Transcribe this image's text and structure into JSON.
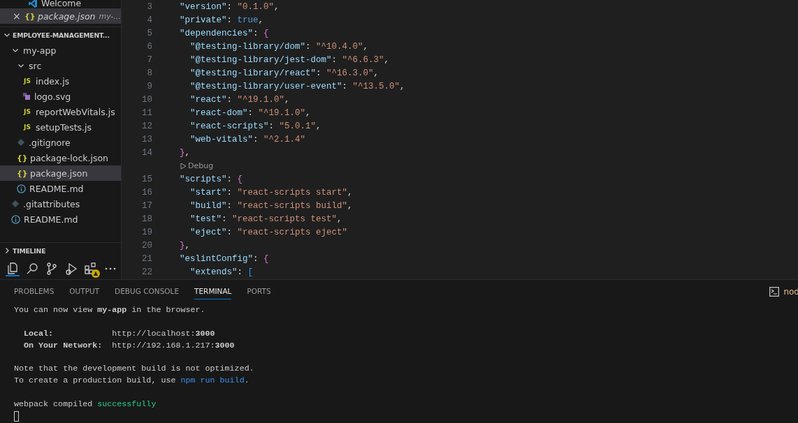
{
  "open_editors": [
    {
      "kind": "vscode",
      "name": "Welcome",
      "selected": false,
      "preview": false
    },
    {
      "kind": "json",
      "badge": "{}",
      "name": "package.json",
      "description": "my-...",
      "close": "×",
      "selected": true,
      "preview": true
    }
  ],
  "explorer": {
    "title": "EMPLOYEE-MANAGEMENT...",
    "expanded": true,
    "items": [
      {
        "name": "my-app",
        "kind": "folder",
        "expanded": true,
        "selected": false,
        "children": [
          {
            "name": "src",
            "kind": "folder",
            "expanded": true,
            "selected": false,
            "children": [
              {
                "name": "index.js",
                "kind": "js",
                "badge": "JS",
                "selected": false
              },
              {
                "name": "logo.svg",
                "kind": "svg",
                "selected": false
              },
              {
                "name": "reportWebVitals.js",
                "kind": "js",
                "badge": "JS",
                "selected": false
              },
              {
                "name": "setupTests.js",
                "kind": "js",
                "badge": "JS",
                "selected": false
              }
            ]
          },
          {
            "name": ".gitignore",
            "kind": "git",
            "selected": false
          },
          {
            "name": "package-lock.json",
            "kind": "json",
            "badge": "{}",
            "selected": false
          },
          {
            "name": "package.json",
            "kind": "json",
            "badge": "{}",
            "selected": true
          },
          {
            "name": "README.md",
            "kind": "info",
            "selected": false
          }
        ]
      },
      {
        "name": ".gitattributes",
        "kind": "git",
        "selected": false
      },
      {
        "name": "README.md",
        "kind": "info",
        "selected": false
      }
    ]
  },
  "timeline": {
    "title": "TIMELINE",
    "expanded": false
  },
  "activity_bar": [
    {
      "kind": "explorer",
      "selected": true
    },
    {
      "kind": "search",
      "selected": false
    },
    {
      "kind": "source-control",
      "selected": false
    },
    {
      "kind": "run-debug",
      "selected": false
    },
    {
      "kind": "extensions",
      "selected": false,
      "warning": true
    },
    {
      "kind": "more",
      "selected": false
    }
  ],
  "editor": {
    "lines": [
      {
        "kind": "code",
        "number": "3",
        "tokens": [
          {
            "kind": "key",
            "text": "\"version\""
          },
          {
            "kind": "punct",
            "text": ": "
          },
          {
            "kind": "string",
            "text": "\"0.1.0\""
          },
          {
            "kind": "punct",
            "text": ","
          }
        ]
      },
      {
        "kind": "code",
        "number": "4",
        "tokens": [
          {
            "kind": "key",
            "text": "\"private\""
          },
          {
            "kind": "punct",
            "text": ": "
          },
          {
            "kind": "bool",
            "text": "true"
          },
          {
            "kind": "punct",
            "text": ","
          }
        ]
      },
      {
        "kind": "code",
        "number": "5",
        "tokens": [
          {
            "kind": "key",
            "text": "\"dependencies\""
          },
          {
            "kind": "punct",
            "text": ": "
          },
          {
            "kind": "bracket2",
            "text": "{"
          }
        ]
      },
      {
        "kind": "code",
        "number": "6",
        "tokens": [
          {
            "kind": "key",
            "text": "\"@testing-library/dom\""
          },
          {
            "kind": "punct",
            "text": ": "
          },
          {
            "kind": "string",
            "text": "\"^10.4.0\""
          },
          {
            "kind": "punct",
            "text": ","
          }
        ]
      },
      {
        "kind": "code",
        "number": "7",
        "tokens": [
          {
            "kind": "key",
            "text": "\"@testing-library/jest-dom\""
          },
          {
            "kind": "punct",
            "text": ": "
          },
          {
            "kind": "string",
            "text": "\"^6.6.3\""
          },
          {
            "kind": "punct",
            "text": ","
          }
        ]
      },
      {
        "kind": "code",
        "number": "8",
        "tokens": [
          {
            "kind": "key",
            "text": "\"@testing-library/react\""
          },
          {
            "kind": "punct",
            "text": ": "
          },
          {
            "kind": "string",
            "text": "\"^16.3.0\""
          },
          {
            "kind": "punct",
            "text": ","
          }
        ]
      },
      {
        "kind": "code",
        "number": "9",
        "tokens": [
          {
            "kind": "key",
            "text": "\"@testing-library/user-event\""
          },
          {
            "kind": "punct",
            "text": ": "
          },
          {
            "kind": "string",
            "text": "\"^13.5.0\""
          },
          {
            "kind": "punct",
            "text": ","
          }
        ]
      },
      {
        "kind": "code",
        "number": "10",
        "tokens": [
          {
            "kind": "key",
            "text": "\"react\""
          },
          {
            "kind": "punct",
            "text": ": "
          },
          {
            "kind": "string",
            "text": "\"^19.1.0\""
          },
          {
            "kind": "punct",
            "text": ","
          }
        ]
      },
      {
        "kind": "code",
        "number": "11",
        "tokens": [
          {
            "kind": "key",
            "text": "\"react-dom\""
          },
          {
            "kind": "punct",
            "text": ": "
          },
          {
            "kind": "string",
            "text": "\"^19.1.0\""
          },
          {
            "kind": "punct",
            "text": ","
          }
        ]
      },
      {
        "kind": "code",
        "number": "12",
        "tokens": [
          {
            "kind": "key",
            "text": "\"react-scripts\""
          },
          {
            "kind": "punct",
            "text": ": "
          },
          {
            "kind": "string",
            "text": "\"5.0.1\""
          },
          {
            "kind": "punct",
            "text": ","
          }
        ]
      },
      {
        "kind": "code",
        "number": "13",
        "tokens": [
          {
            "kind": "key",
            "text": "\"web-vitals\""
          },
          {
            "kind": "punct",
            "text": ": "
          },
          {
            "kind": "string",
            "text": "\"^2.1.4\""
          }
        ]
      },
      {
        "kind": "code",
        "number": "14",
        "tokens": [
          {
            "kind": "bracket2",
            "text": "}"
          },
          {
            "kind": "punct",
            "text": ","
          }
        ]
      },
      {
        "kind": "codelens",
        "text": "Debug"
      },
      {
        "kind": "code",
        "number": "15",
        "tokens": [
          {
            "kind": "key",
            "text": "\"scripts\""
          },
          {
            "kind": "punct",
            "text": ": "
          },
          {
            "kind": "bracket2",
            "text": "{"
          }
        ]
      },
      {
        "kind": "code",
        "number": "16",
        "tokens": [
          {
            "kind": "key",
            "text": "\"start\""
          },
          {
            "kind": "punct",
            "text": ": "
          },
          {
            "kind": "string",
            "text": "\"react-scripts start\""
          },
          {
            "kind": "punct",
            "text": ","
          }
        ]
      },
      {
        "kind": "code",
        "number": "17",
        "tokens": [
          {
            "kind": "key",
            "text": "\"build\""
          },
          {
            "kind": "punct",
            "text": ": "
          },
          {
            "kind": "string",
            "text": "\"react-scripts build\""
          },
          {
            "kind": "punct",
            "text": ","
          }
        ]
      },
      {
        "kind": "code",
        "number": "18",
        "tokens": [
          {
            "kind": "key",
            "text": "\"test\""
          },
          {
            "kind": "punct",
            "text": ": "
          },
          {
            "kind": "string",
            "text": "\"react-scripts test\""
          },
          {
            "kind": "punct",
            "text": ","
          }
        ]
      },
      {
        "kind": "code",
        "number": "19",
        "tokens": [
          {
            "kind": "key",
            "text": "\"eject\""
          },
          {
            "kind": "punct",
            "text": ": "
          },
          {
            "kind": "string",
            "text": "\"react-scripts eject\""
          }
        ]
      },
      {
        "kind": "code",
        "number": "20",
        "tokens": [
          {
            "kind": "bracket2",
            "text": "}"
          },
          {
            "kind": "punct",
            "text": ","
          }
        ]
      },
      {
        "kind": "code",
        "number": "21",
        "tokens": [
          {
            "kind": "key",
            "text": "\"eslintConfig\""
          },
          {
            "kind": "punct",
            "text": ": "
          },
          {
            "kind": "bracket2",
            "text": "{"
          }
        ]
      },
      {
        "kind": "code",
        "number": "22",
        "tokens": [
          {
            "kind": "key",
            "text": "\"extends\""
          },
          {
            "kind": "punct",
            "text": ": "
          },
          {
            "kind": "bracket3",
            "text": "["
          }
        ]
      }
    ]
  },
  "panel": {
    "tabs": [
      {
        "label": "PROBLEMS",
        "selected": false
      },
      {
        "label": "OUTPUT",
        "selected": false
      },
      {
        "label": "DEBUG CONSOLE",
        "selected": false
      },
      {
        "label": "TERMINAL",
        "selected": true
      },
      {
        "label": "PORTS",
        "selected": false
      }
    ],
    "terminal_name": "nod",
    "terminal": [
      {
        "lines": [
          [
            {
              "kind": "plain",
              "text": "You can now view "
            },
            {
              "kind": "bold",
              "text": "my-app"
            },
            {
              "kind": "plain",
              "text": " in the browser."
            }
          ]
        ]
      },
      {
        "lines": [
          [
            {
              "kind": "bold",
              "text": "  Local:"
            },
            {
              "kind": "plain",
              "text": "            http://localhost:"
            },
            {
              "kind": "bold",
              "text": "3000"
            }
          ],
          [
            {
              "kind": "bold",
              "text": "  On Your Network:"
            },
            {
              "kind": "plain",
              "text": "  http://192.168.1.217:"
            },
            {
              "kind": "bold",
              "text": "3000"
            }
          ]
        ]
      },
      {
        "lines": [
          [
            {
              "kind": "plain",
              "text": "Note that the development build is not optimized."
            }
          ],
          [
            {
              "kind": "plain",
              "text": "To create a production build, use "
            },
            {
              "kind": "link",
              "text": "npm run build"
            },
            {
              "kind": "plain",
              "text": "."
            }
          ]
        ]
      },
      {
        "lines": [
          [
            {
              "kind": "plain",
              "text": "webpack compiled "
            },
            {
              "kind": "success",
              "text": "successfully"
            }
          ]
        ]
      }
    ],
    "cursor": true
  }
}
